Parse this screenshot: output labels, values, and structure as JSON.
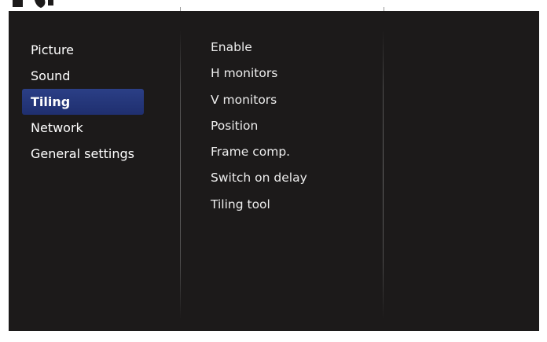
{
  "menu": {
    "items": [
      {
        "label": "Picture",
        "selected": false
      },
      {
        "label": "Sound",
        "selected": false
      },
      {
        "label": "Tiling",
        "selected": true
      },
      {
        "label": "Network",
        "selected": false
      },
      {
        "label": "General settings",
        "selected": false
      }
    ]
  },
  "submenu": {
    "items": [
      {
        "label": "Enable"
      },
      {
        "label": "H monitors"
      },
      {
        "label": "V monitors"
      },
      {
        "label": "Position"
      },
      {
        "label": "Frame comp."
      },
      {
        "label": "Switch on delay"
      },
      {
        "label": "Tiling tool"
      }
    ]
  },
  "colors": {
    "background": "#1c1a1a",
    "selected_highlight": "#263a80",
    "text": "#ffffff"
  }
}
